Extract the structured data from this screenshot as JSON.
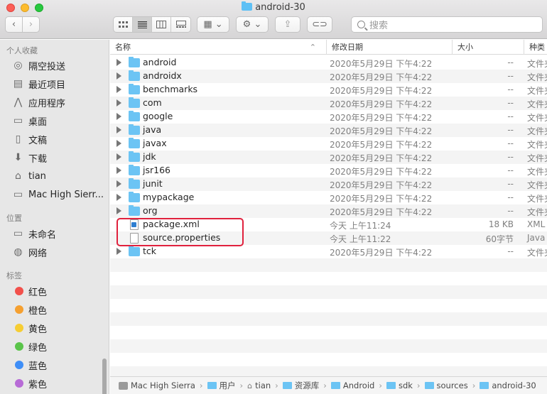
{
  "window": {
    "title": "android-30"
  },
  "toolbar": {
    "back_glyph": "‹",
    "forward_glyph": "›",
    "search_placeholder": "搜索",
    "view_modes": [
      "icon-view",
      "list-view",
      "column-view",
      "gallery-view"
    ],
    "selected_view": "list-view",
    "group_glyph": "▦ ⌄",
    "action_glyph": "⚙ ⌄",
    "share_glyph": "⇪",
    "tag_glyph": "⊂⊃"
  },
  "sidebar": {
    "favorites_header": "个人收藏",
    "favorites": [
      {
        "label": "隔空投送",
        "icon": "airdrop-icon",
        "glyph": "◎"
      },
      {
        "label": "最近项目",
        "icon": "recents-icon",
        "glyph": "▤"
      },
      {
        "label": "应用程序",
        "icon": "applications-icon",
        "glyph": "⋀"
      },
      {
        "label": "桌面",
        "icon": "desktop-icon",
        "glyph": "▭"
      },
      {
        "label": "文稿",
        "icon": "documents-icon",
        "glyph": "▯"
      },
      {
        "label": "下载",
        "icon": "downloads-icon",
        "glyph": "⬇"
      },
      {
        "label": "tian",
        "icon": "home-icon",
        "glyph": "⌂"
      },
      {
        "label": "Mac High Sierr...",
        "icon": "hard-drive-icon",
        "glyph": "▭"
      }
    ],
    "locations_header": "位置",
    "locations": [
      {
        "label": "未命名",
        "icon": "disk-icon",
        "glyph": "▭"
      },
      {
        "label": "网络",
        "icon": "network-icon",
        "glyph": "◍"
      }
    ],
    "tags_header": "标签",
    "tags": [
      {
        "label": "红色",
        "color": "#f2504b"
      },
      {
        "label": "橙色",
        "color": "#f5a030"
      },
      {
        "label": "黄色",
        "color": "#f6cd33"
      },
      {
        "label": "绿色",
        "color": "#5ac44a"
      },
      {
        "label": "蓝色",
        "color": "#3e8ef7"
      },
      {
        "label": "紫色",
        "color": "#b76bd6"
      }
    ]
  },
  "columns": {
    "name": "名称",
    "date": "修改日期",
    "size": "大小",
    "kind": "种类",
    "sort_glyph": "⌃"
  },
  "files": [
    {
      "name": "android",
      "date": "2020年5月29日 下午4:22",
      "size": "--",
      "kind": "文件夹",
      "type": "folder"
    },
    {
      "name": "androidx",
      "date": "2020年5月29日 下午4:22",
      "size": "--",
      "kind": "文件夹",
      "type": "folder"
    },
    {
      "name": "benchmarks",
      "date": "2020年5月29日 下午4:22",
      "size": "--",
      "kind": "文件夹",
      "type": "folder"
    },
    {
      "name": "com",
      "date": "2020年5月29日 下午4:22",
      "size": "--",
      "kind": "文件夹",
      "type": "folder"
    },
    {
      "name": "google",
      "date": "2020年5月29日 下午4:22",
      "size": "--",
      "kind": "文件夹",
      "type": "folder"
    },
    {
      "name": "java",
      "date": "2020年5月29日 下午4:22",
      "size": "--",
      "kind": "文件夹",
      "type": "folder"
    },
    {
      "name": "javax",
      "date": "2020年5月29日 下午4:22",
      "size": "--",
      "kind": "文件夹",
      "type": "folder"
    },
    {
      "name": "jdk",
      "date": "2020年5月29日 下午4:22",
      "size": "--",
      "kind": "文件夹",
      "type": "folder"
    },
    {
      "name": "jsr166",
      "date": "2020年5月29日 下午4:22",
      "size": "--",
      "kind": "文件夹",
      "type": "folder"
    },
    {
      "name": "junit",
      "date": "2020年5月29日 下午4:22",
      "size": "--",
      "kind": "文件夹",
      "type": "folder"
    },
    {
      "name": "mypackage",
      "date": "2020年5月29日 下午4:22",
      "size": "--",
      "kind": "文件夹",
      "type": "folder"
    },
    {
      "name": "org",
      "date": "2020年5月29日 下午4:22",
      "size": "--",
      "kind": "文件夹",
      "type": "folder"
    },
    {
      "name": "package.xml",
      "date": "今天 上午11:24",
      "size": "18 KB",
      "kind": "XML",
      "type": "xml"
    },
    {
      "name": "source.properties",
      "date": "今天 上午11:22",
      "size": "60字节",
      "kind": "Java",
      "type": "doc"
    },
    {
      "name": "tck",
      "date": "2020年5月29日 下午4:22",
      "size": "--",
      "kind": "文件夹",
      "type": "folder"
    }
  ],
  "pathbar": [
    {
      "label": "Mac High Sierra",
      "icon": "hd"
    },
    {
      "label": "用户",
      "icon": "folder"
    },
    {
      "label": "tian",
      "icon": "home"
    },
    {
      "label": "资源库",
      "icon": "folder"
    },
    {
      "label": "Android",
      "icon": "folder"
    },
    {
      "label": "sdk",
      "icon": "folder"
    },
    {
      "label": "sources",
      "icon": "folder"
    },
    {
      "label": "android-30",
      "icon": "folder"
    }
  ],
  "pathbar_separator": "›"
}
